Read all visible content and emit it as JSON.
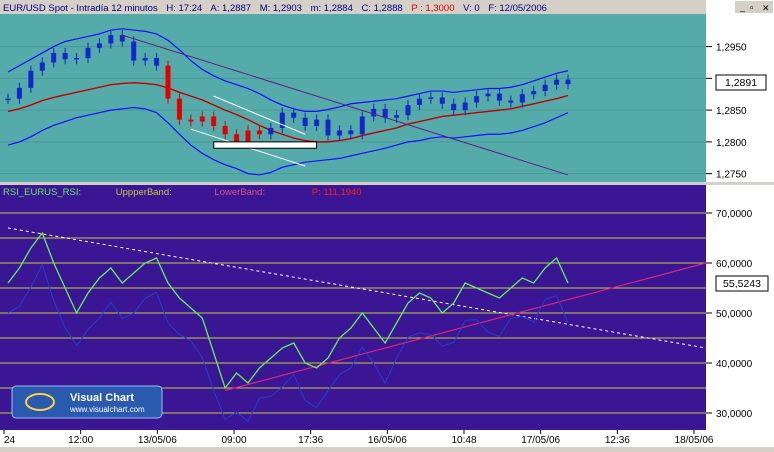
{
  "colors": {
    "price_bg": "#55aaaa",
    "rsi_bg": "#3a1694",
    "axis_bg": "#ffffff",
    "up_bar": "#1428c8",
    "down_bar": "#e00000",
    "ma": "#c00000",
    "bands": "#1010ff",
    "trend_purple": "#602080",
    "rsi_line": "#60ee60",
    "rsi_lower_band": "#2040d0",
    "level_lines": "#c8c840",
    "dotted_trend": "#ffffff",
    "rsi_support": "#e0207a"
  },
  "price_panel": {
    "symbol_label": "EUR/USD Spot - Intradía 12 minutos",
    "h_label": "H: 17:24",
    "a_label": "A: 1,2887",
    "m_label": "M: 1,2903",
    "mn_label": "m: 1,2884",
    "c_label": "C: 1,2888",
    "p_label": "P : 1,3000",
    "v_label": "V: 0",
    "f_label": "F: 12/05/2006",
    "last_price": "1,2891"
  },
  "rsi_panel": {
    "name_label": "RSI_EURUS_RSI:",
    "upper_label": "UppperBand:",
    "lower_label": "LowerBand:",
    "p_label": "P: 111,1940",
    "last_value": "55,5243"
  },
  "logo": {
    "title": "Visual Chart",
    "url": "www.visualchart.com"
  },
  "window_controls": {
    "minimize": "_",
    "restore": "▫",
    "close": "✕"
  },
  "chart_data": [
    {
      "type": "candlestick",
      "title": "EUR/USD Spot - Intradía 12 minutos",
      "ylim": [
        1.274,
        1.2995
      ],
      "yticks": [
        "1,2950",
        "1,2900",
        "1,2850",
        "1,2800",
        "1,2750"
      ],
      "ytick_values": [
        1.295,
        1.29,
        1.285,
        1.28,
        1.275
      ],
      "last_value": 1.2891,
      "series": [
        {
          "name": "Price",
          "values": [
            1.2868,
            1.2885,
            1.2912,
            1.2925,
            1.294,
            1.293,
            1.2932,
            1.2948,
            1.2955,
            1.2968,
            1.2958,
            1.2928,
            1.2932,
            1.292,
            1.2868,
            1.2835,
            1.2832,
            1.284,
            1.2825,
            1.2812,
            1.28,
            1.2818,
            1.2812,
            1.2822,
            1.2846,
            1.2838,
            1.2825,
            1.2835,
            1.281,
            1.2818,
            1.2812,
            1.284,
            1.2852,
            1.2838,
            1.2842,
            1.2858,
            1.2868,
            1.287,
            1.286,
            1.285,
            1.2862,
            1.2872,
            1.2876,
            1.2865,
            1.2862,
            1.2875,
            1.288,
            1.289,
            1.2898,
            1.2891
          ]
        },
        {
          "name": "Moving average",
          "values": [
            1.2848,
            1.2852,
            1.2858,
            1.2865,
            1.287,
            1.2874,
            1.2878,
            1.2882,
            1.2886,
            1.289,
            1.2892,
            1.2893,
            1.2892,
            1.289,
            1.2885,
            1.2878,
            1.2872,
            1.2866,
            1.2858,
            1.285,
            1.2843,
            1.2835,
            1.2826,
            1.2818,
            1.2812,
            1.2806,
            1.2802,
            1.28,
            1.28,
            1.2802,
            1.2805,
            1.281,
            1.2814,
            1.2818,
            1.2822,
            1.2828,
            1.2832,
            1.2836,
            1.284,
            1.2842,
            1.2844,
            1.2846,
            1.2848,
            1.285,
            1.2852,
            1.2856,
            1.286,
            1.2864,
            1.2868,
            1.2873
          ]
        },
        {
          "name": "Upper band",
          "values": [
            1.291,
            1.292,
            1.293,
            1.294,
            1.295,
            1.2958,
            1.2962,
            1.2966,
            1.297,
            1.2976,
            1.2978,
            1.2976,
            1.2974,
            1.297,
            1.296,
            1.2945,
            1.2928,
            1.2914,
            1.2904,
            1.2896,
            1.289,
            1.2884,
            1.2876,
            1.2866,
            1.2858,
            1.2852,
            1.2848,
            1.2848,
            1.2851,
            1.2855,
            1.286,
            1.2862,
            1.2864,
            1.2866,
            1.2868,
            1.2872,
            1.2876,
            1.288,
            1.288,
            1.2878,
            1.288,
            1.2882,
            1.2884,
            1.2884,
            1.2886,
            1.289,
            1.2896,
            1.2902,
            1.2908,
            1.2912
          ]
        },
        {
          "name": "Lower band",
          "values": [
            1.2795,
            1.28,
            1.2808,
            1.2818,
            1.2826,
            1.2832,
            1.2838,
            1.2842,
            1.2846,
            1.285,
            1.2852,
            1.2854,
            1.2852,
            1.2846,
            1.283,
            1.2812,
            1.2795,
            1.2782,
            1.2772,
            1.2764,
            1.2758,
            1.275,
            1.2748,
            1.2752,
            1.276,
            1.2764,
            1.2768,
            1.277,
            1.2772,
            1.2774,
            1.2778,
            1.2782,
            1.2786,
            1.279,
            1.2795,
            1.28,
            1.2802,
            1.2806,
            1.2808,
            1.2806,
            1.2808,
            1.281,
            1.2812,
            1.2812,
            1.2814,
            1.2818,
            1.2824,
            1.283,
            1.2838,
            1.2846
          ]
        }
      ]
    },
    {
      "type": "line",
      "title": "RSI_EURUS_RSI",
      "ylim": [
        27,
        75
      ],
      "yticks": [
        "70,0000",
        "60,0000",
        "50,0000",
        "40,0000",
        "30,0000"
      ],
      "ytick_values": [
        70,
        60,
        50,
        40,
        30
      ],
      "level_lines": [
        70,
        65,
        60,
        55,
        50,
        45,
        40,
        35,
        30
      ],
      "last_value": 55.5243,
      "series": [
        {
          "name": "RSI",
          "values": [
            56,
            59,
            63,
            66,
            60,
            55,
            50,
            54,
            57,
            59,
            56,
            58,
            60,
            61,
            56,
            53,
            51,
            49,
            42,
            35,
            38,
            36,
            39,
            41,
            43,
            44,
            40,
            39,
            41,
            45,
            47,
            50,
            47,
            44,
            48,
            52,
            54,
            53,
            50,
            52,
            56,
            55,
            54,
            53,
            55,
            57,
            56,
            59,
            61,
            56
          ]
        }
      ]
    }
  ],
  "x_axis": {
    "labels": [
      "24",
      "12:00",
      "13/05/06",
      "09:00",
      "17:36",
      "16/05/06",
      "10:48",
      "17/05/06",
      "12:36",
      "18/05/06"
    ]
  }
}
